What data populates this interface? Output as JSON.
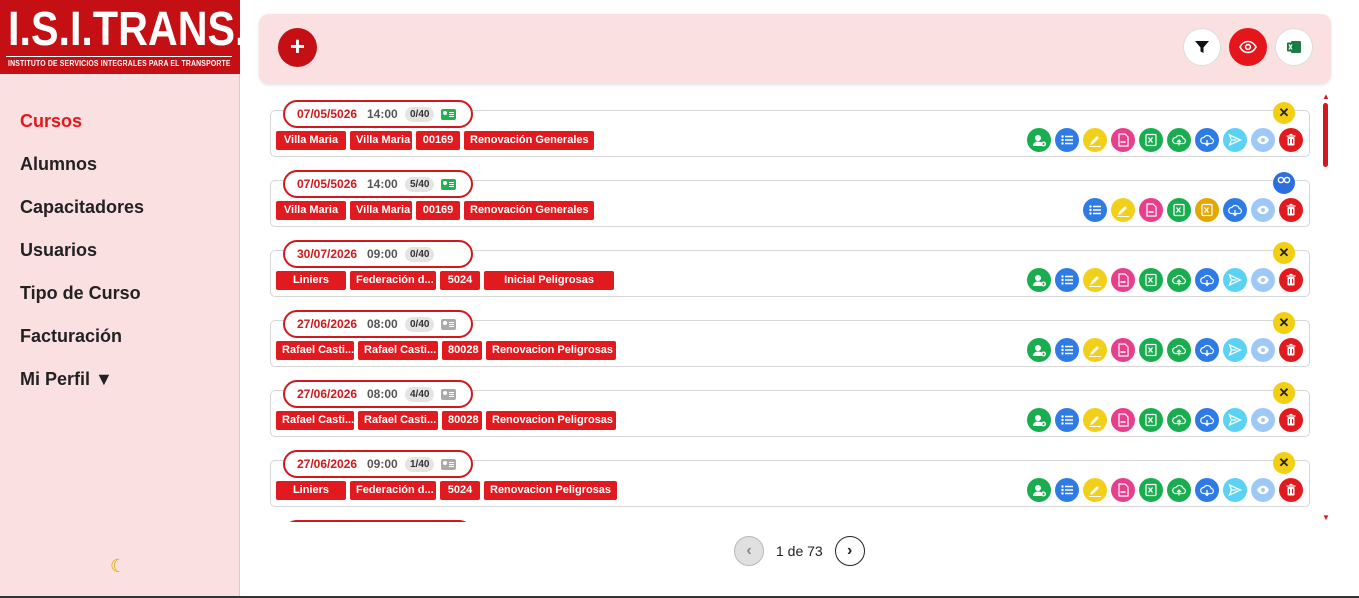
{
  "logo": {
    "main": "I.S.I.TRANS.",
    "sub": "INSTITUTO DE SERVICIOS INTEGRALES PARA EL TRANSPORTE"
  },
  "nav": [
    {
      "label": "Cursos",
      "active": true
    },
    {
      "label": "Alumnos"
    },
    {
      "label": "Capacitadores"
    },
    {
      "label": "Usuarios"
    },
    {
      "label": "Tipo de Curso"
    },
    {
      "label": "Facturación"
    },
    {
      "label": "Mi Perfil ▼"
    }
  ],
  "toolbar": {
    "add": "+"
  },
  "courses": [
    {
      "date": "07/05/5026",
      "time": "14:00",
      "count": "0/40",
      "card": "on",
      "status": "close",
      "tags": [
        "Villa Maria",
        "Villa Maria",
        "00169",
        "Renovación Generales"
      ],
      "actions": [
        "add-student",
        "list",
        "edit",
        "pdf",
        "excel",
        "upload",
        "download",
        "send",
        "view",
        "delete"
      ]
    },
    {
      "date": "07/05/5026",
      "time": "14:00",
      "count": "5/40",
      "card": "on",
      "status": "view",
      "tags": [
        "Villa Maria",
        "Villa Maria",
        "00169",
        "Renovación Generales"
      ],
      "actions": [
        "list",
        "edit",
        "pdf",
        "excel",
        "excel-yellow",
        "download",
        "view",
        "delete"
      ]
    },
    {
      "date": "30/07/2026",
      "time": "09:00",
      "count": "0/40",
      "card": "none",
      "status": "close",
      "tags": [
        "Liniers",
        "Federación d...",
        "5024",
        "Inicial Peligrosas"
      ],
      "actions": [
        "add-student",
        "list",
        "edit",
        "pdf",
        "excel",
        "upload",
        "download",
        "send",
        "view",
        "delete"
      ]
    },
    {
      "date": "27/06/2026",
      "time": "08:00",
      "count": "0/40",
      "card": "off",
      "status": "close",
      "tags": [
        "Rafael Casti...",
        "Rafael Casti...",
        "80028",
        "Renovacion Peligrosas"
      ],
      "actions": [
        "add-student",
        "list",
        "edit",
        "pdf",
        "excel",
        "upload",
        "download",
        "send",
        "view",
        "delete"
      ]
    },
    {
      "date": "27/06/2026",
      "time": "08:00",
      "count": "4/40",
      "card": "off",
      "status": "close",
      "tags": [
        "Rafael Casti...",
        "Rafael Casti...",
        "80028",
        "Renovacion Peligrosas"
      ],
      "actions": [
        "add-student",
        "list",
        "edit",
        "pdf",
        "excel",
        "upload",
        "download",
        "send",
        "view",
        "delete"
      ]
    },
    {
      "date": "27/06/2026",
      "time": "09:00",
      "count": "1/40",
      "card": "off",
      "status": "close",
      "tags": [
        "Liniers",
        "Federación d...",
        "5024",
        "Renovacion Peligrosas"
      ],
      "actions": [
        "add-student",
        "list",
        "edit",
        "pdf",
        "excel",
        "upload",
        "download",
        "send",
        "view",
        "delete"
      ]
    }
  ],
  "pager": {
    "text": "1 de 73"
  },
  "colors": {
    "brand": "#c40f14",
    "tag": "#e01a1e",
    "panel": "#fbe0e1"
  }
}
